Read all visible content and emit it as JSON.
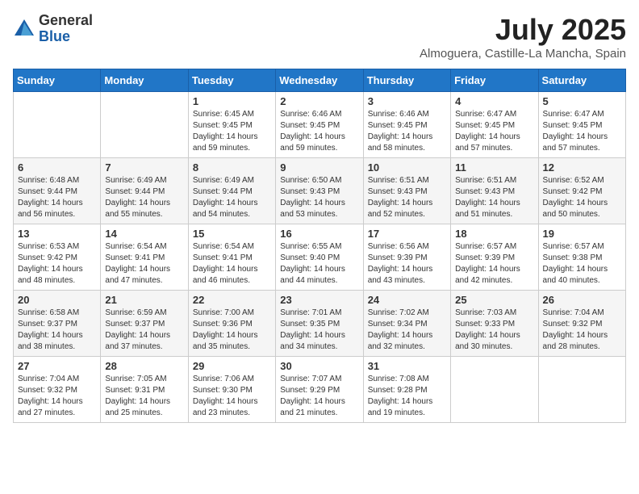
{
  "logo": {
    "general": "General",
    "blue": "Blue"
  },
  "title": "July 2025",
  "location": "Almoguera, Castille-La Mancha, Spain",
  "days_of_week": [
    "Sunday",
    "Monday",
    "Tuesday",
    "Wednesday",
    "Thursday",
    "Friday",
    "Saturday"
  ],
  "weeks": [
    [
      {
        "day": "",
        "info": ""
      },
      {
        "day": "",
        "info": ""
      },
      {
        "day": "1",
        "info": "Sunrise: 6:45 AM\nSunset: 9:45 PM\nDaylight: 14 hours and 59 minutes."
      },
      {
        "day": "2",
        "info": "Sunrise: 6:46 AM\nSunset: 9:45 PM\nDaylight: 14 hours and 59 minutes."
      },
      {
        "day": "3",
        "info": "Sunrise: 6:46 AM\nSunset: 9:45 PM\nDaylight: 14 hours and 58 minutes."
      },
      {
        "day": "4",
        "info": "Sunrise: 6:47 AM\nSunset: 9:45 PM\nDaylight: 14 hours and 57 minutes."
      },
      {
        "day": "5",
        "info": "Sunrise: 6:47 AM\nSunset: 9:45 PM\nDaylight: 14 hours and 57 minutes."
      }
    ],
    [
      {
        "day": "6",
        "info": "Sunrise: 6:48 AM\nSunset: 9:44 PM\nDaylight: 14 hours and 56 minutes."
      },
      {
        "day": "7",
        "info": "Sunrise: 6:49 AM\nSunset: 9:44 PM\nDaylight: 14 hours and 55 minutes."
      },
      {
        "day": "8",
        "info": "Sunrise: 6:49 AM\nSunset: 9:44 PM\nDaylight: 14 hours and 54 minutes."
      },
      {
        "day": "9",
        "info": "Sunrise: 6:50 AM\nSunset: 9:43 PM\nDaylight: 14 hours and 53 minutes."
      },
      {
        "day": "10",
        "info": "Sunrise: 6:51 AM\nSunset: 9:43 PM\nDaylight: 14 hours and 52 minutes."
      },
      {
        "day": "11",
        "info": "Sunrise: 6:51 AM\nSunset: 9:43 PM\nDaylight: 14 hours and 51 minutes."
      },
      {
        "day": "12",
        "info": "Sunrise: 6:52 AM\nSunset: 9:42 PM\nDaylight: 14 hours and 50 minutes."
      }
    ],
    [
      {
        "day": "13",
        "info": "Sunrise: 6:53 AM\nSunset: 9:42 PM\nDaylight: 14 hours and 48 minutes."
      },
      {
        "day": "14",
        "info": "Sunrise: 6:54 AM\nSunset: 9:41 PM\nDaylight: 14 hours and 47 minutes."
      },
      {
        "day": "15",
        "info": "Sunrise: 6:54 AM\nSunset: 9:41 PM\nDaylight: 14 hours and 46 minutes."
      },
      {
        "day": "16",
        "info": "Sunrise: 6:55 AM\nSunset: 9:40 PM\nDaylight: 14 hours and 44 minutes."
      },
      {
        "day": "17",
        "info": "Sunrise: 6:56 AM\nSunset: 9:39 PM\nDaylight: 14 hours and 43 minutes."
      },
      {
        "day": "18",
        "info": "Sunrise: 6:57 AM\nSunset: 9:39 PM\nDaylight: 14 hours and 42 minutes."
      },
      {
        "day": "19",
        "info": "Sunrise: 6:57 AM\nSunset: 9:38 PM\nDaylight: 14 hours and 40 minutes."
      }
    ],
    [
      {
        "day": "20",
        "info": "Sunrise: 6:58 AM\nSunset: 9:37 PM\nDaylight: 14 hours and 38 minutes."
      },
      {
        "day": "21",
        "info": "Sunrise: 6:59 AM\nSunset: 9:37 PM\nDaylight: 14 hours and 37 minutes."
      },
      {
        "day": "22",
        "info": "Sunrise: 7:00 AM\nSunset: 9:36 PM\nDaylight: 14 hours and 35 minutes."
      },
      {
        "day": "23",
        "info": "Sunrise: 7:01 AM\nSunset: 9:35 PM\nDaylight: 14 hours and 34 minutes."
      },
      {
        "day": "24",
        "info": "Sunrise: 7:02 AM\nSunset: 9:34 PM\nDaylight: 14 hours and 32 minutes."
      },
      {
        "day": "25",
        "info": "Sunrise: 7:03 AM\nSunset: 9:33 PM\nDaylight: 14 hours and 30 minutes."
      },
      {
        "day": "26",
        "info": "Sunrise: 7:04 AM\nSunset: 9:32 PM\nDaylight: 14 hours and 28 minutes."
      }
    ],
    [
      {
        "day": "27",
        "info": "Sunrise: 7:04 AM\nSunset: 9:32 PM\nDaylight: 14 hours and 27 minutes."
      },
      {
        "day": "28",
        "info": "Sunrise: 7:05 AM\nSunset: 9:31 PM\nDaylight: 14 hours and 25 minutes."
      },
      {
        "day": "29",
        "info": "Sunrise: 7:06 AM\nSunset: 9:30 PM\nDaylight: 14 hours and 23 minutes."
      },
      {
        "day": "30",
        "info": "Sunrise: 7:07 AM\nSunset: 9:29 PM\nDaylight: 14 hours and 21 minutes."
      },
      {
        "day": "31",
        "info": "Sunrise: 7:08 AM\nSunset: 9:28 PM\nDaylight: 14 hours and 19 minutes."
      },
      {
        "day": "",
        "info": ""
      },
      {
        "day": "",
        "info": ""
      }
    ]
  ]
}
